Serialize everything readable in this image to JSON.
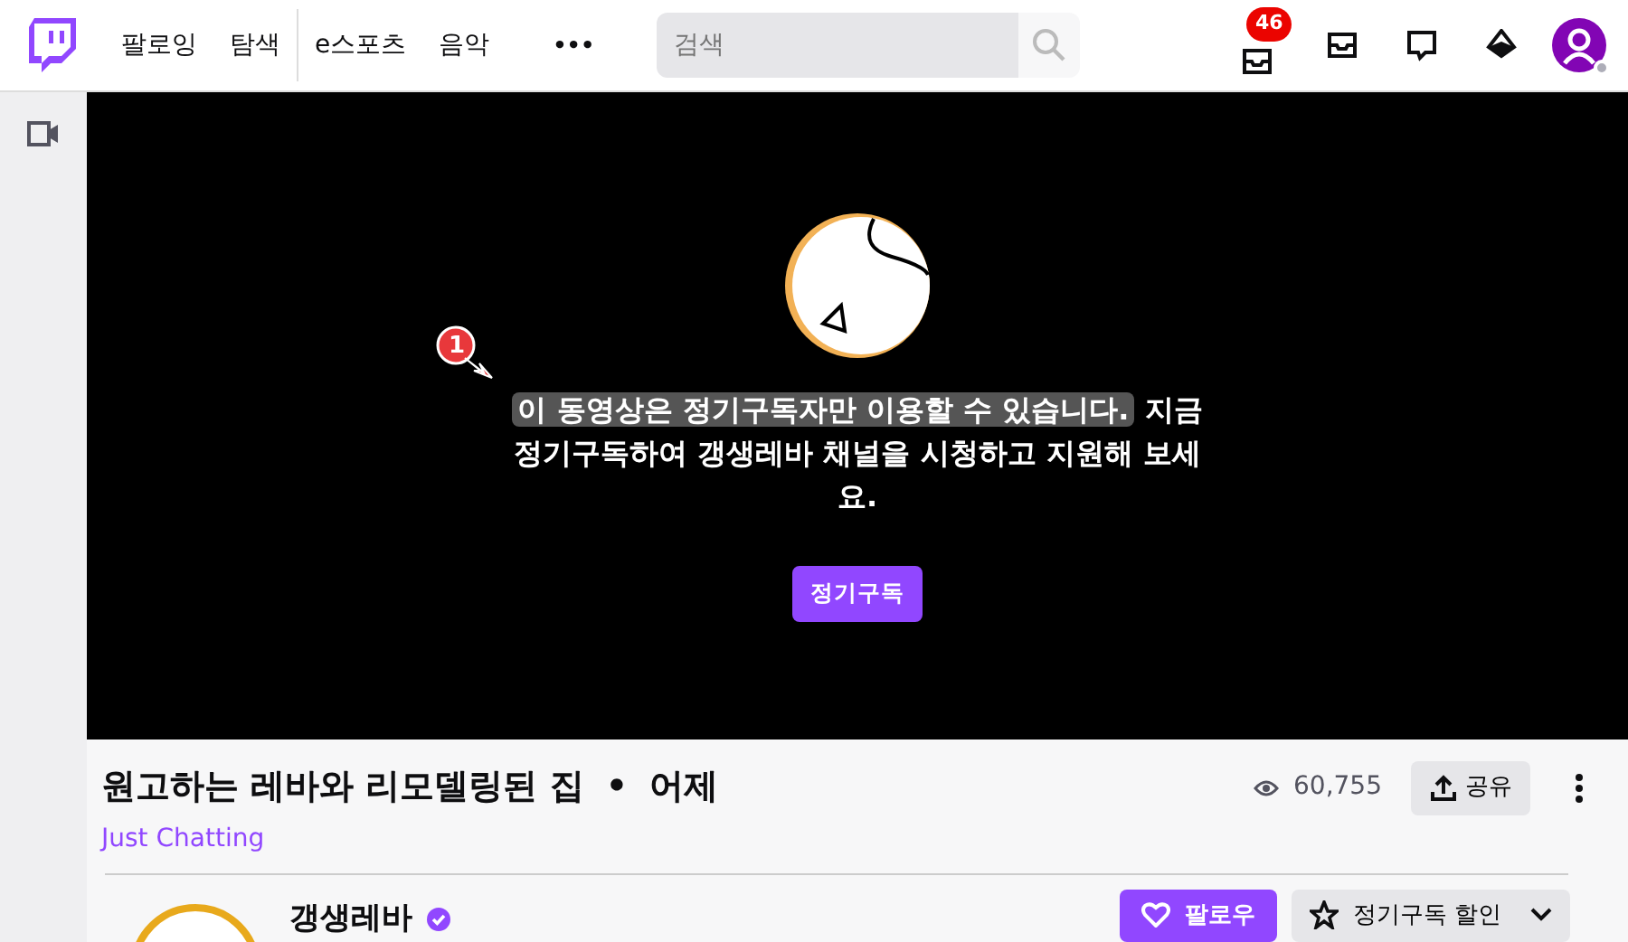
{
  "nav": {
    "items": [
      {
        "label": "팔로잉",
        "divider_after": false
      },
      {
        "label": "탐색",
        "divider_after": true
      },
      {
        "label": "e스포츠",
        "divider_after": false
      },
      {
        "label": "음악",
        "divider_after": false
      }
    ],
    "more": "•••",
    "search": {
      "placeholder": "검색"
    },
    "notification_count": "46"
  },
  "player": {
    "message": [
      {
        "text": "이 동영상은 정기구독자만 이용할 수 있습니다.",
        "highlighted": true
      },
      {
        "text": "지금 정기구독하여 갱생레바 채널을 시청하고 지원해 보세요.",
        "highlighted": false
      }
    ],
    "button": "정기구독",
    "annotation": "1"
  },
  "video": {
    "title": "원고하는 레바와 리모델링된 집",
    "separator": "•",
    "date": "어제",
    "category": "Just Chatting",
    "views": "60,755",
    "share": "공유"
  },
  "channel": {
    "name": "갱생레바",
    "verified": true,
    "follow": "팔로우",
    "subscribe": "정기구독 할인"
  }
}
